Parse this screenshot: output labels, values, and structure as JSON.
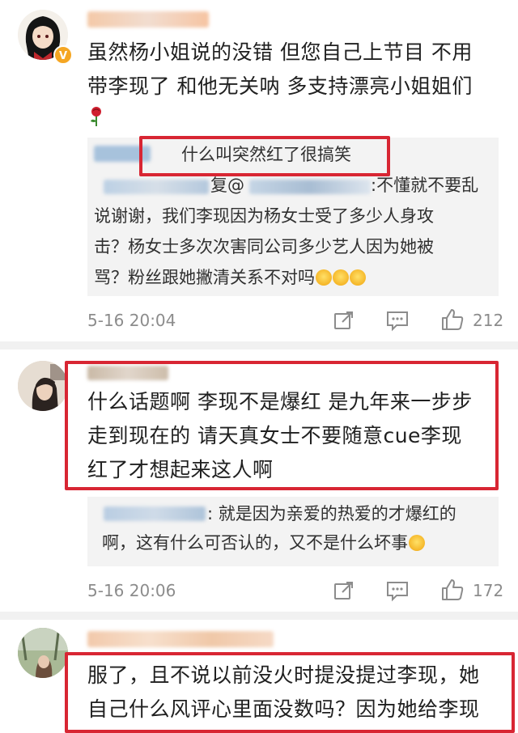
{
  "comments": [
    {
      "text_lines": [
        "虽然杨小姐说的没错 但您自己上节目 不用",
        "带李现了 和他无关呐 多支持漂亮小姐姐们"
      ],
      "emoji": "rose",
      "reply": {
        "first_line": "什么叫突然红了很搞笑",
        "second_prefix": "复@",
        "second_text": ":不懂就不要乱",
        "lines": [
          "说谢谢，我们李现因为杨女士受了多少人身攻",
          "击？杨女士多次次害同公司多少艺人因为她被",
          "骂？粉丝跟她撇清关系不对吗"
        ]
      },
      "time": "5-16 20:04",
      "likes": "212"
    },
    {
      "text_lines": [
        "什么话题啊 李现不是爆红 是九年来一步步",
        "走到现在的 请天真女士不要随意cue李现",
        "红了才想起来这人啊"
      ],
      "reply": {
        "lines": [
          ": 就是因为亲爱的热爱的才爆红的",
          "啊，这有什么可否认的，又不是什么坏事"
        ]
      },
      "time": "5-16 20:06",
      "likes": "172"
    },
    {
      "text_lines": [
        "服了，且不说以前没火时提没提过李现，她",
        "自己什么风评心里面没数吗？因为她给李现"
      ]
    }
  ],
  "icons": {
    "share": "share-icon",
    "comment": "comment-icon",
    "like": "like-icon",
    "verified": "verified-badge-icon"
  },
  "colors": {
    "highlight_border": "#d82633",
    "verified": "#f5a623",
    "meta": "#8c8c8c"
  }
}
